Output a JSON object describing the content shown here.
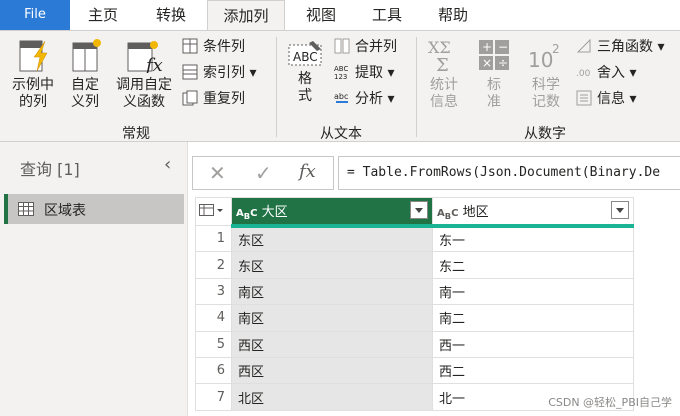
{
  "tabs": [
    "File",
    "主页",
    "转换",
    "添加列",
    "视图",
    "工具",
    "帮助"
  ],
  "ribbon": {
    "examples_label": "示例中\n的列",
    "custom_col_label": "自定\n义列",
    "invoke_fn_label": "调用自定\n义函数",
    "conditional_label": "条件列",
    "index_label": "索引列",
    "duplicate_label": "重复列",
    "group_general": "常规",
    "format_label": "格\n式",
    "merge_label": "合并列",
    "extract_label": "提取",
    "parse_label": "分析",
    "group_text": "从文本",
    "stats_label": "统计\n信息",
    "standard_label": "标\n准",
    "scientific_label": "科学\n记数",
    "trig_label": "三角函数",
    "round_label": "舍入",
    "info_label": "信息",
    "group_number": "从数字"
  },
  "queries": {
    "header": "查询 [1]",
    "items": [
      "区域表"
    ]
  },
  "formula": {
    "text": "= Table.FromRows(Json.Document(Binary.De"
  },
  "table": {
    "headers": [
      "大区",
      "地区"
    ],
    "rows": [
      {
        "n": "1",
        "a": "东区",
        "b": "东一"
      },
      {
        "n": "2",
        "a": "东区",
        "b": "东二"
      },
      {
        "n": "3",
        "a": "南区",
        "b": "南一"
      },
      {
        "n": "4",
        "a": "南区",
        "b": "南二"
      },
      {
        "n": "5",
        "a": "西区",
        "b": "西一"
      },
      {
        "n": "6",
        "a": "西区",
        "b": "西二"
      },
      {
        "n": "7",
        "a": "北区",
        "b": "北一"
      }
    ]
  },
  "watermark": "CSDN @轻松_PBI自己学",
  "colors": {
    "accent": "#217346",
    "file_tab": "#2b7bd6",
    "header_underline": "#1ab394"
  }
}
